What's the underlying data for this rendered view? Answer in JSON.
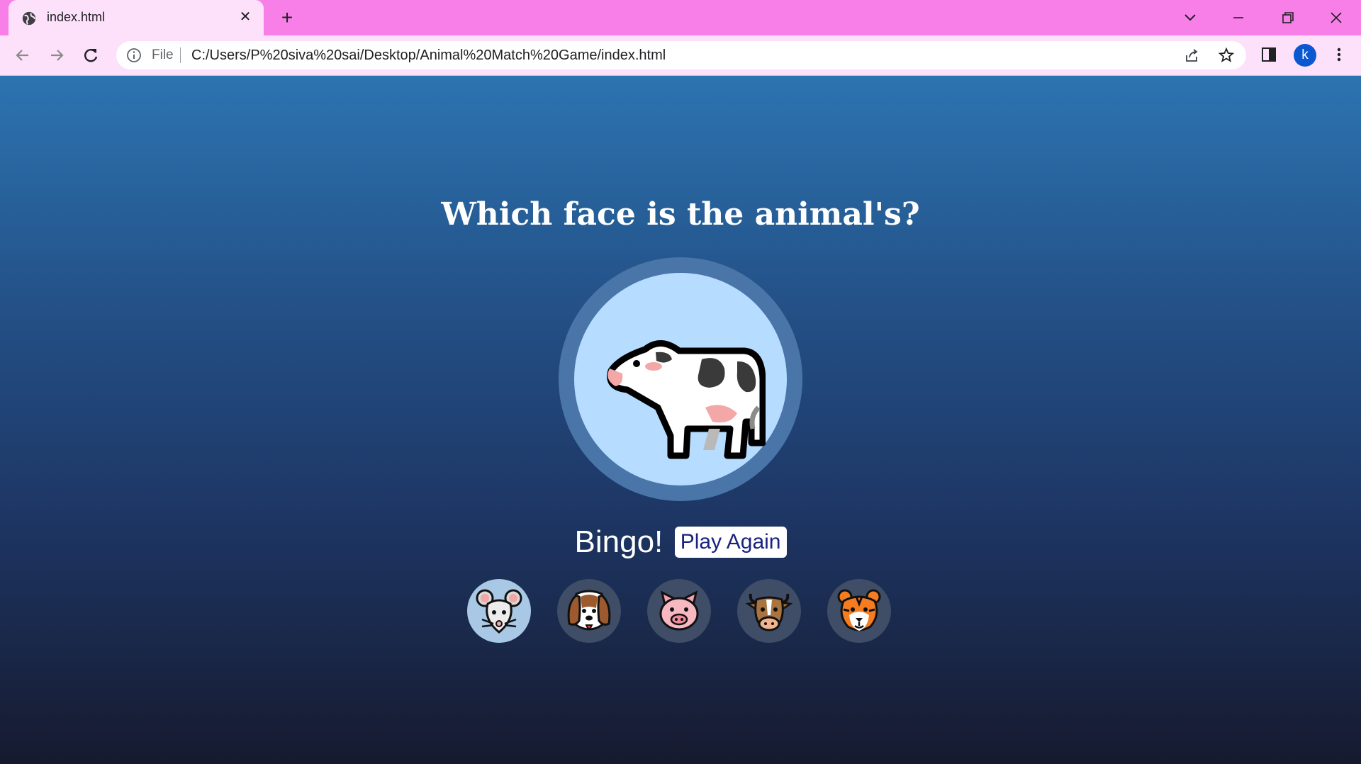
{
  "browser": {
    "tab_title": "index.html",
    "file_label": "File",
    "url": "C:/Users/P%20siva%20sai/Desktop/Animal%20Match%20Game/index.html",
    "avatar_letter": "k",
    "frame_color": "#f97fe8",
    "toolbar_color": "#fde0fa"
  },
  "game": {
    "question": "Which face is the animal's?",
    "target_animal": "cow-icon",
    "result_text": "Bingo!",
    "play_again_label": "Play Again",
    "choices": [
      {
        "icon": "mouse-face-icon",
        "selected": true
      },
      {
        "icon": "dog-face-icon",
        "selected": false
      },
      {
        "icon": "pig-face-icon",
        "selected": false
      },
      {
        "icon": "cow-face-icon",
        "selected": false
      },
      {
        "icon": "tiger-face-icon",
        "selected": false
      }
    ]
  }
}
